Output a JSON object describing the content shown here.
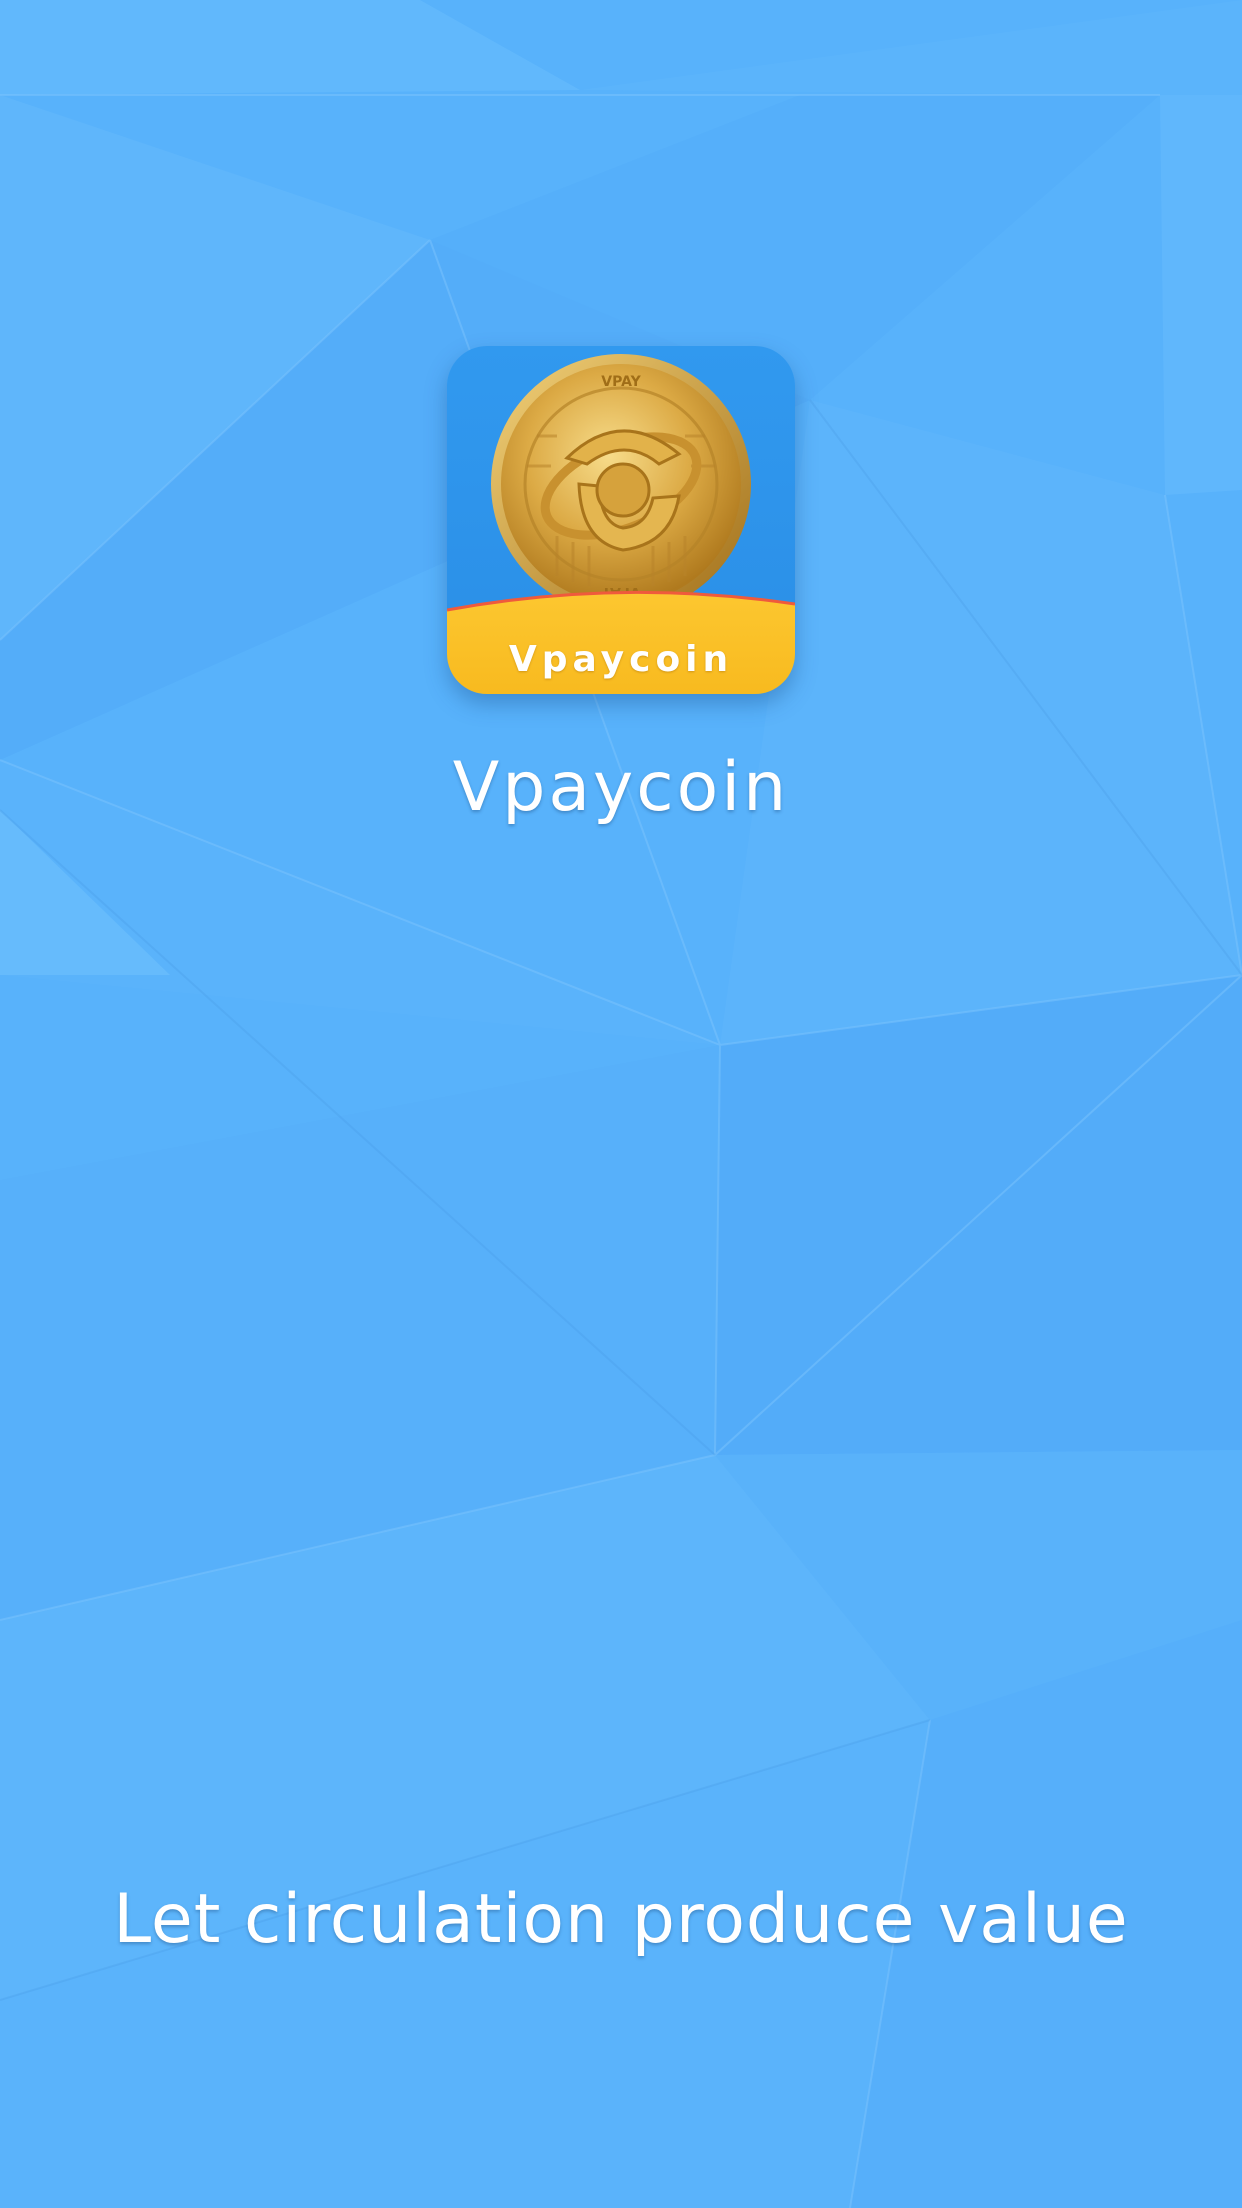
{
  "splash": {
    "app_name": "Vpaycoin",
    "icon_label": "Vpaycoin",
    "coin_text": "VPAY",
    "slogan": "Let circulation produce value"
  },
  "icons": {
    "logo": "gold-coin-logo-icon"
  },
  "colors": {
    "background": "#58b2fb",
    "icon_background": "#2a8ee6",
    "icon_banner": "#fcc52c",
    "coin_gold": "#d9a63a",
    "text": "#ffffff"
  }
}
